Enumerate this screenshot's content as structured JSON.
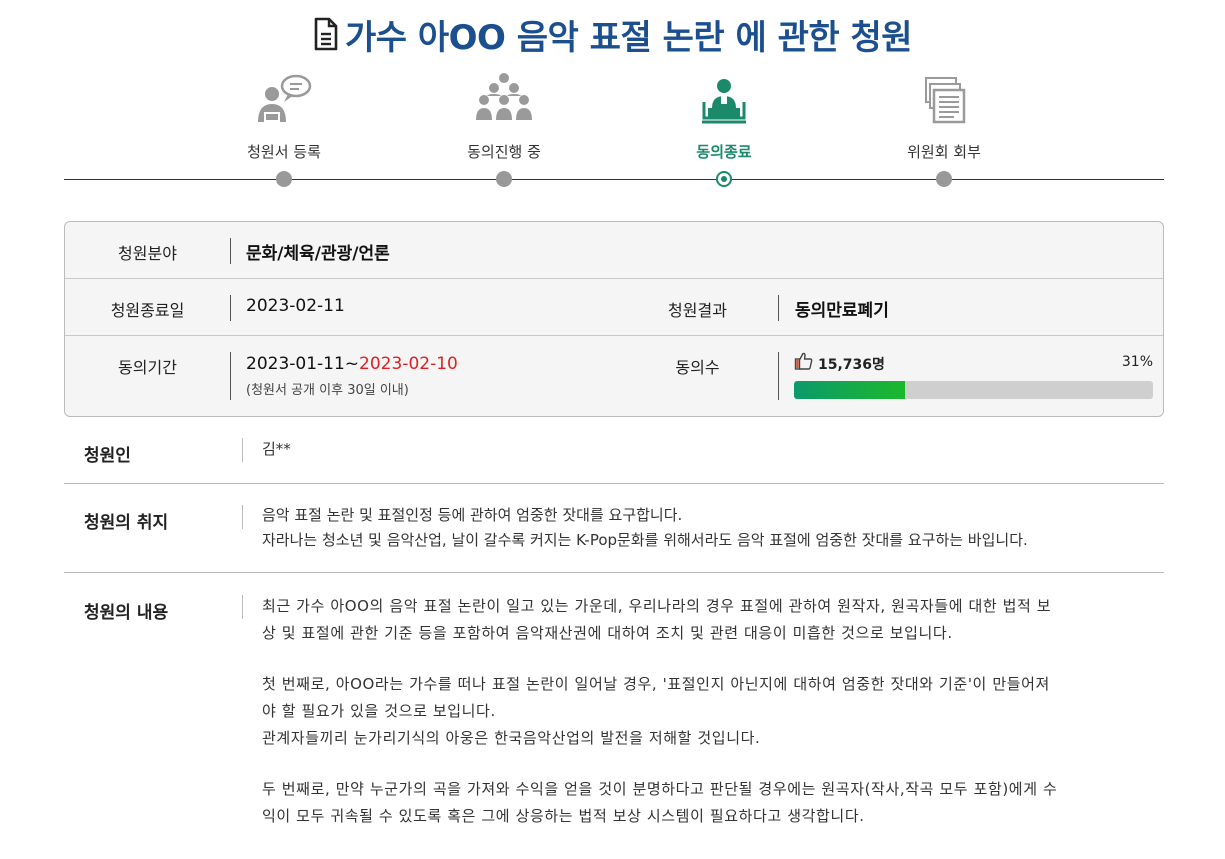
{
  "page": {
    "title": "가수 아OO 음악 표절 논란 에 관한 청원",
    "title_icon": "document-icon",
    "accent_color": "#1b4f8f",
    "active_color": "#1b8a6b"
  },
  "steps": [
    {
      "label": "청원서 등록",
      "icon": "speaker-speech-bubble-icon",
      "active": false
    },
    {
      "label": "동의진행 중",
      "icon": "group-people-icon",
      "active": false
    },
    {
      "label": "동의종료",
      "icon": "person-at-podium-icon",
      "active": true
    },
    {
      "label": "위원회 회부",
      "icon": "document-stack-icon",
      "active": false
    }
  ],
  "info": {
    "category_label": "청원분야",
    "category_value": "문화/체육/관광/언론",
    "end_date_label": "청원종료일",
    "end_date_value": "2023-02-11",
    "result_label": "청원결과",
    "result_value": "동의만료폐기",
    "period_label": "동의기간",
    "period_start": "2023-01-11~",
    "period_end": "2023-02-10",
    "period_note": "(청원서 공개 이후 30일 이내)",
    "agree_label": "동의수",
    "agree_count": "15,736명",
    "agree_percent": "31%",
    "agree_progress": 0.31,
    "progress_colors": [
      "#0a9a6c",
      "#1cb82c"
    ]
  },
  "petitioner": {
    "label": "청원인",
    "value": "김**"
  },
  "purpose": {
    "label": "청원의 취지",
    "lines": [
      "음악 표절 논란 및 표절인정 등에 관하여 엄중한 잣대를 요구합니다.",
      "자라나는 청소년 및 음악산업, 날이 갈수록 커지는 K-Pop문화를 위해서라도 음악 표절에 엄중한 잣대를 요구하는 바입니다."
    ]
  },
  "content": {
    "label": "청원의 내용",
    "paragraphs": [
      [
        "최근 가수 아OO의 음악 표절 논란이 일고 있는 가운데, 우리나라의 경우 표절에 관하여 원작자, 원곡자들에 대한 법적 보",
        "상 및 표절에 관한 기준 등을 포함하여 음악재산권에 대하여 조치 및 관련 대응이 미흡한 것으로 보입니다."
      ],
      [
        "첫 번째로, 아OO라는 가수를 떠나 표절 논란이 일어날 경우, '표절인지 아닌지에 대하여 엄중한 잣대와 기준'이 만들어져",
        "야 할 필요가 있을 것으로 보입니다.",
        "관계자들끼리 눈가리기식의 아웅은 한국음악산업의 발전을 저해할 것입니다."
      ],
      [
        "두 번째로, 만약 누군가의 곡을 가져와 수익을 얻을 것이 분명하다고 판단될 경우에는 원곡자(작사,작곡 모두 포함)에게 수",
        "익이 모두 귀속될 수 있도록 혹은 그에 상응하는 법적 보상 시스템이 필요하다고 생각합니다."
      ]
    ]
  }
}
